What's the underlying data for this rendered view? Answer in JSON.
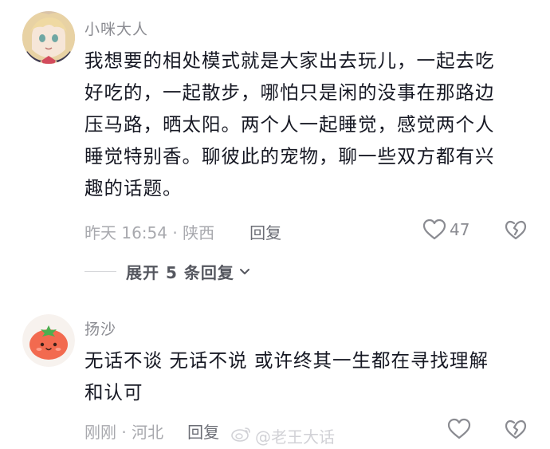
{
  "comments": [
    {
      "username": "小咪大人",
      "lines": [
        "我想要的相处模式就是大家出去玩儿，一起去吃",
        "好吃的，一起散步，哪怕只是闲的没事在那路边",
        "压马路，晒太阳。两个人一起睡觉，感觉两个人",
        "睡觉特别香。聊彼此的宠物，聊一些双方都有兴",
        "趣的话题。"
      ],
      "time_location": "昨天 16:54 · 陕西",
      "reply_label": "回复",
      "like_count": "47",
      "expand_label": "展开 5 条回复"
    },
    {
      "username": "扬沙",
      "lines": [
        "无话不谈 无话不说 或许终其一生都在寻找理解",
        "和认可"
      ],
      "time_location": "刚刚 · 河北",
      "reply_label": "回复"
    }
  ],
  "watermark": "@老王大话",
  "icons": {
    "like": "heart-outline-icon",
    "dislike": "broken-heart-icon",
    "expand": "chevron-down-icon",
    "watermark": "weibo-logo-icon"
  }
}
